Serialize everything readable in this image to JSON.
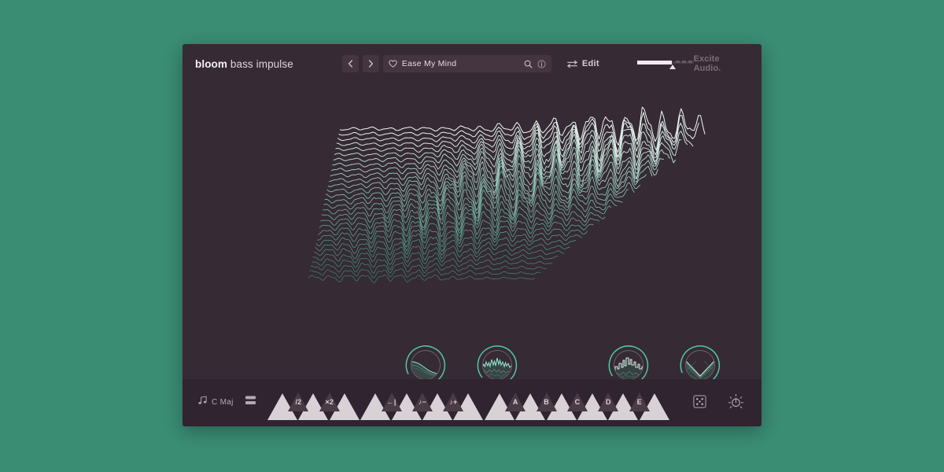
{
  "theme": {
    "outer_background": "#3a8c73",
    "panel_background": "#362a34",
    "bottom_bar_background": "#2f2430",
    "accent_teal": "#4fc9a3",
    "accent_pale": "#e8f3ee",
    "control_background": "#443540",
    "text_primary": "#e9e2e7",
    "text_muted": "#7d6c78",
    "key_white": "#d8d2d6",
    "key_black": "#4a3b45"
  },
  "header": {
    "brand_bold": "bloom",
    "brand_light": "bass impulse",
    "prev_label": "‹",
    "next_label": "›",
    "preset_name": "Ease My Mind",
    "preset_placeholder": "Ease My Mind",
    "favourite_icon": "heart-icon",
    "search_icon": "search-icon",
    "info_icon": "info-icon",
    "edit_icon": "sliders-icon",
    "edit_label": "Edit",
    "master_fader": {
      "name": "master-level-fader",
      "value_percent": 61
    },
    "vendor": "Excite Audio."
  },
  "visualizer": {
    "name": "wavetable-3d-display",
    "type": "3d-waterfall",
    "row_count": 30,
    "front_color": "#3fbd95",
    "back_color": "#eef7f2"
  },
  "knobs": [
    {
      "name": "knob-shape",
      "icon": "curve-decay-icon",
      "arc_percent": 70
    },
    {
      "name": "knob-texture",
      "icon": "spectrum-noise-icon",
      "arc_percent": 62
    },
    {
      "name": "knob-spike",
      "icon": "spectrum-peak-icon",
      "arc_percent": 67
    },
    {
      "name": "knob-blend",
      "icon": "crossfade-x-icon",
      "arc_percent": 72
    }
  ],
  "bottom_bar": {
    "scale_icon": "music-note-icon",
    "scale_label": "C Maj",
    "layers_icon": "layers-icon",
    "dice_icon": "randomize-icon",
    "power_icon": "power-icon",
    "white_keys": [
      {
        "index": 0
      },
      {
        "index": 1
      },
      {
        "index": 2
      },
      {
        "index": 3
      },
      {
        "index": 4
      },
      {
        "index": 5
      },
      {
        "index": 6
      },
      {
        "index": 7
      },
      {
        "index": 8
      },
      {
        "index": 9
      },
      {
        "index": 10
      },
      {
        "index": 11
      },
      {
        "index": 12
      }
    ],
    "black_keys": [
      {
        "label": "/2",
        "after": 0
      },
      {
        "label": "×2",
        "after": 1
      },
      {
        "label": "←|",
        "after": 3
      },
      {
        "label": "♪−",
        "after": 4
      },
      {
        "label": "♪+",
        "after": 5
      },
      {
        "label": "A",
        "after": 7
      },
      {
        "label": "B",
        "after": 8
      },
      {
        "label": "C",
        "after": 9
      },
      {
        "label": "D",
        "after": 10
      },
      {
        "label": "E",
        "after": 11
      }
    ]
  }
}
